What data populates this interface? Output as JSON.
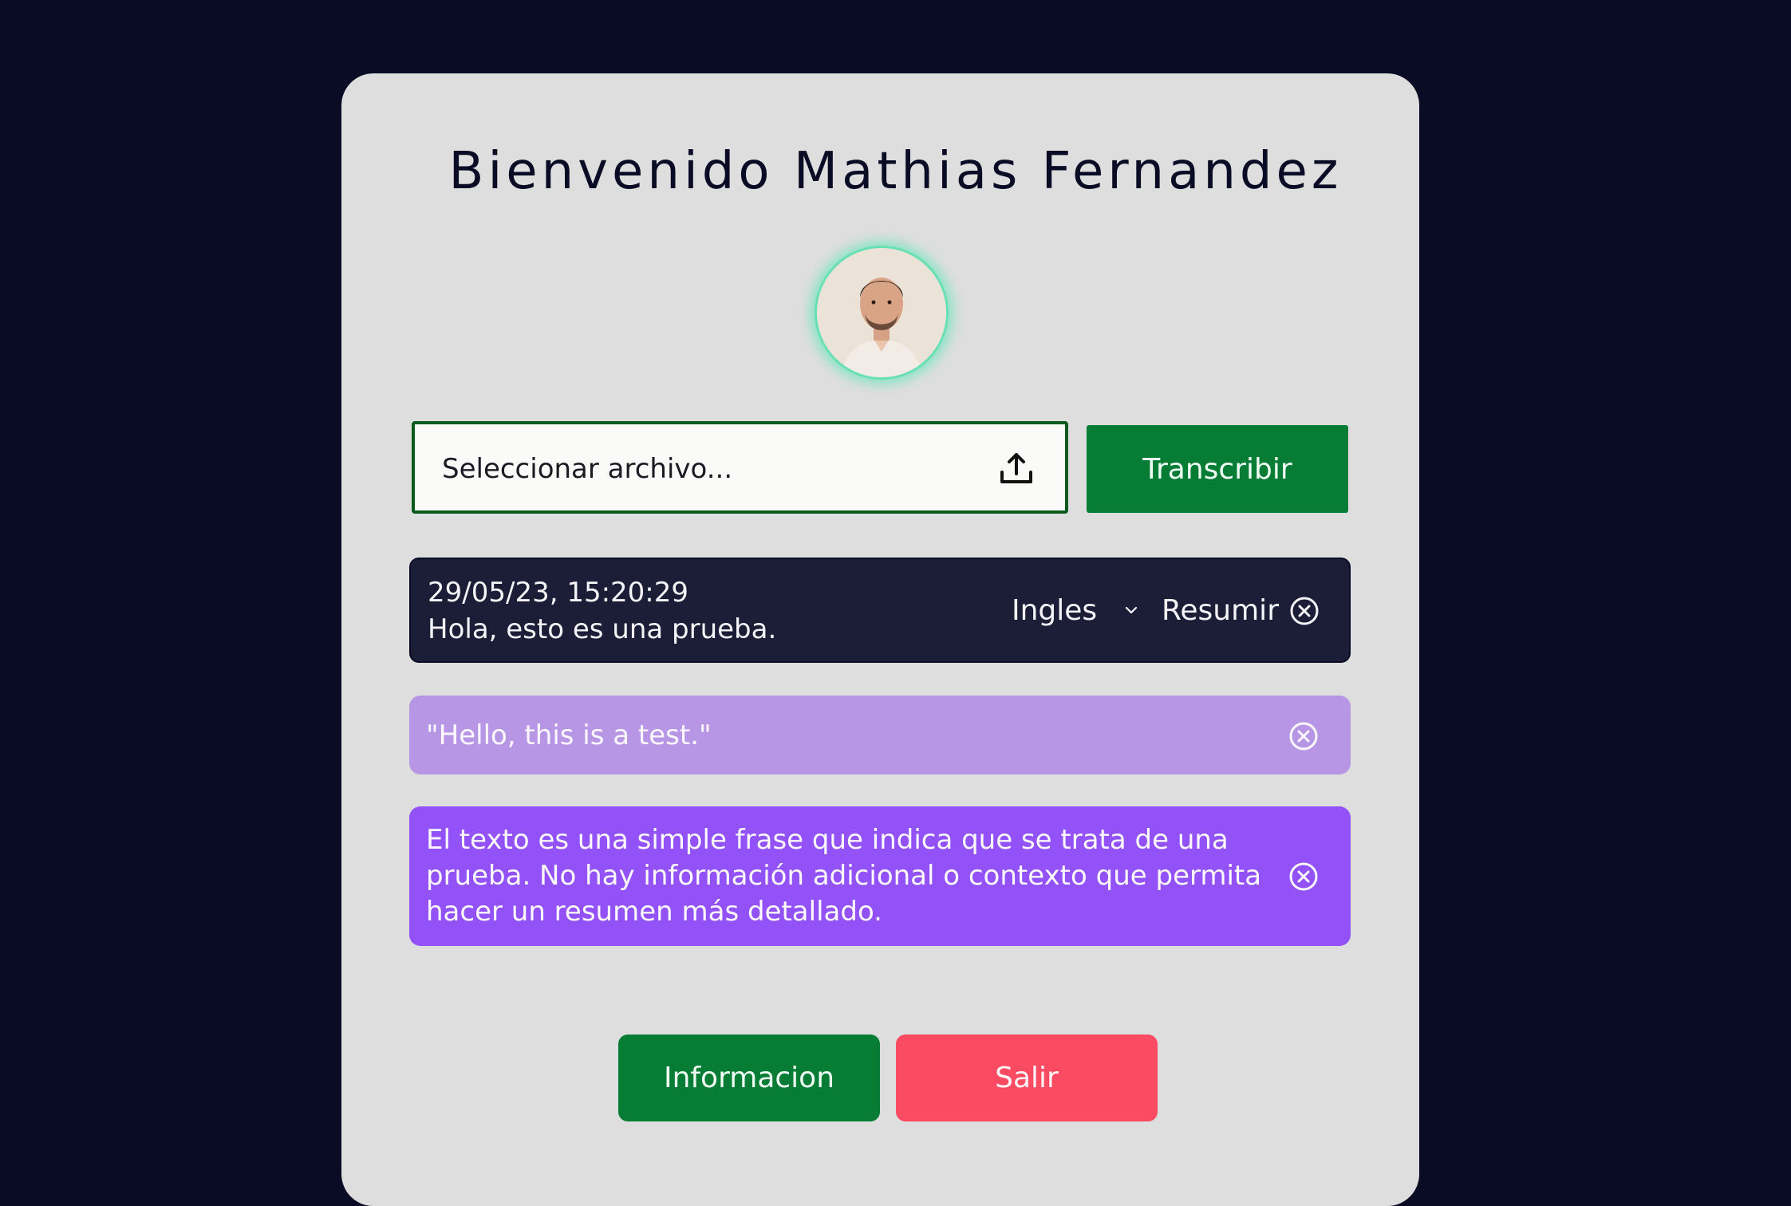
{
  "header": {
    "title": "Bienvenido Mathias Fernandez"
  },
  "upload": {
    "placeholder": "Seleccionar archivo...",
    "icon": "upload-icon",
    "transcribe_label": "Transcribir"
  },
  "transcription": {
    "datetime": "29/05/23, 15:20:29",
    "text": "Hola, esto es una prueba.",
    "language": "Ingles",
    "summarize_label": "Resumir"
  },
  "translation": {
    "text": "\"Hello, this is a test.\""
  },
  "summary": {
    "text": "El texto es una simple frase que indica que se trata de una prueba. No hay información adicional o contexto que permita hacer un resumen más detallado."
  },
  "footer": {
    "info_label": "Informacion",
    "exit_label": "Salir"
  },
  "colors": {
    "background": "#0a0b24",
    "card": "#dedede",
    "primary_green": "#077c35",
    "danger": "#fb4b63",
    "transcript_bg": "#1c1d36",
    "translation_bg": "#b896e6",
    "summary_bg": "#9352f7",
    "avatar_glow": "#67e0b4"
  }
}
